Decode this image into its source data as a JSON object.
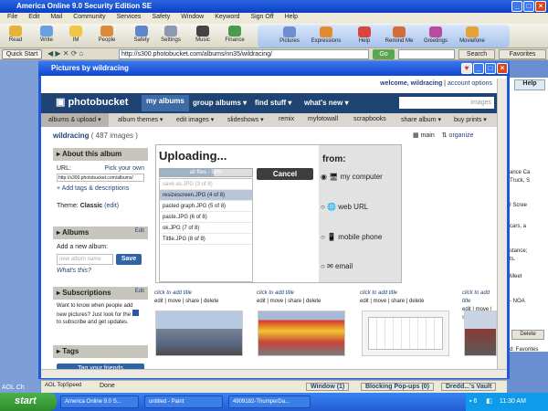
{
  "aol": {
    "title": "America Online 9.0 Security Edition SE",
    "menu": [
      "File",
      "Edit",
      "Mail",
      "Community",
      "Services",
      "Safety",
      "Window",
      "Keyword",
      "Sign Off",
      "Help"
    ],
    "toolbar": [
      "Read",
      "Write",
      "IM",
      "People",
      "Safety",
      "Settings",
      "Music",
      "Finance"
    ],
    "toolbar_right": [
      "Pictures",
      "Expressions",
      "Help",
      "Remind Me",
      "Greetings",
      "Moviefone"
    ],
    "quick_start": "Quick Start",
    "url": "http://s300.photobucket.com/albums/nn35/wildracing/",
    "go": "Go",
    "search": "Search",
    "favorites": "Favorites"
  },
  "browser": {
    "title": "Pictures by wildracing",
    "help": "Help",
    "header_links": [
      "welcome, wildracing",
      "account options"
    ],
    "logo": "photobucket",
    "nav": [
      "my albums",
      "group albums ▾",
      "find stuff ▾",
      "what's new ▾"
    ],
    "search_placeholder": "images",
    "subnav": [
      "albums & upload ▾",
      "album themes ▾",
      "edit images ▾",
      "slideshows ▾",
      "remix",
      "myfotowall",
      "scrapbooks",
      "share album ▾",
      "buy prints ▾"
    ],
    "user": "wildracing",
    "image_count": "( 487 images )",
    "view_main": "main",
    "view_organize": "organize"
  },
  "sidebar": {
    "about_title": "About this album",
    "url_label": "URL:",
    "pick_own": "Pick your own",
    "album_url": "http://s300.photobucket.com/albums/",
    "add_tags": "Add tags & descriptions",
    "theme_label": "Theme:",
    "theme_value": "Classic",
    "theme_edit": "(edit)",
    "albums_title": "Albums",
    "edit": "Edit",
    "add_new_label": "Add a new album:",
    "album_placeholder": "new album name",
    "save": "Save",
    "whats_this": "What's this?",
    "subs_title": "Subscriptions",
    "subs_text": "Want to know when people add new pictures? Just look for the",
    "subs_text2": "to subscribe and get updates.",
    "tags_title": "Tags",
    "tag_friends": "Tag your friends"
  },
  "upload": {
    "title": "Uploading...",
    "progress_label": "all files - 58%",
    "progress": 0.58,
    "cancel": "Cancel",
    "files": [
      "save as.JPG (3 of 8)",
      "resizescreen.JPG (4 of 8)",
      "pasted graph.JPG (5 of 8)",
      "paste.JPG (6 of 8)",
      "ok.JPG (7 of 8)",
      "Tittle.JPG (8 of 8)"
    ],
    "from_label": "from:",
    "sources": [
      "my computer",
      "web URL",
      "mobile phone",
      "email"
    ]
  },
  "thumbs": {
    "click_title": "click to add title",
    "actions": "edit | move | share | delete"
  },
  "status": {
    "topspeed": "AOL TopSpeed",
    "done": "Done",
    "window": "Window (1)",
    "popups": "Blocking Pop-ups (0)",
    "vault": "Dredd...'s Vault"
  },
  "taskbar": {
    "start": "start",
    "tasks": [
      "America Online 9.0 S...",
      "untitled - Paint",
      "4909182-ThumperDa..."
    ],
    "count": "6",
    "time": "11:30 AM"
  },
  "right_strip": [
    "ance Ca",
    "Truck, S",
    "I Scree",
    "cars, a",
    "stance;",
    "ts.",
    "Meet",
    "- NOA"
  ],
  "right_strip_bottom": {
    "delete": "Delete",
    "favorites": "d: Favorites"
  },
  "left_strip": "AOL Ch"
}
